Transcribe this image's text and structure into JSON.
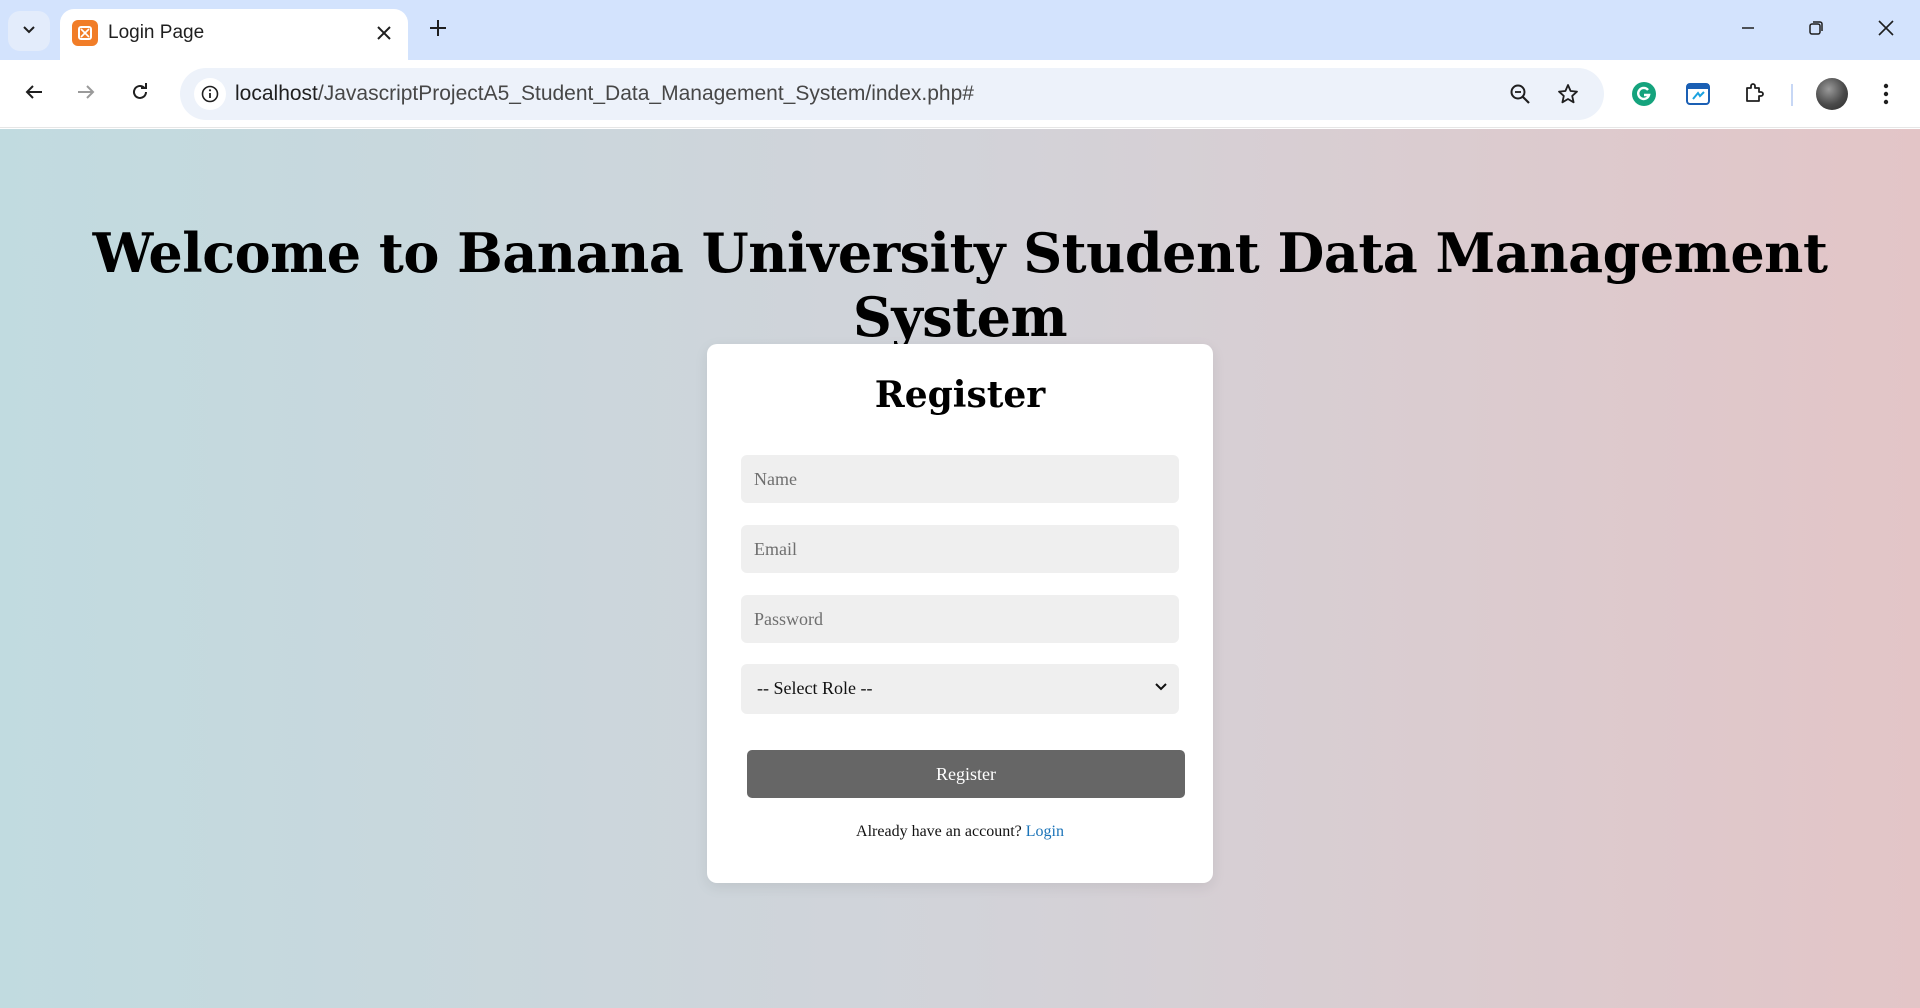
{
  "browser": {
    "tab": {
      "title": "Login Page"
    },
    "url": {
      "host": "localhost",
      "path": "/JavascriptProjectA5_Student_Data_Management_System/index.php#"
    }
  },
  "page": {
    "heading": "Welcome to Banana University Student Data Management System",
    "form": {
      "title": "Register",
      "name_placeholder": "Name",
      "email_placeholder": "Email",
      "password_placeholder": "Password",
      "role_selected": "-- Select Role --",
      "submit_label": "Register",
      "footer_text": "Already have an account?",
      "login_link": "Login"
    }
  },
  "colors": {
    "tabstrip": "#d3e3fd",
    "button": "#666666",
    "link": "#1a73b8",
    "gradient_left": "#c1dbe0",
    "gradient_right": "#e3c5c7"
  },
  "icons": [
    "tab-search-icon",
    "xampp-favicon-icon",
    "close-icon",
    "plus-icon",
    "minimize-icon",
    "restore-icon",
    "window-close-icon",
    "back-arrow-icon",
    "forward-arrow-icon",
    "reload-icon",
    "site-info-icon",
    "zoom-icon",
    "star-icon",
    "grammarly-icon",
    "extension-icon",
    "puzzle-icon",
    "more-vert-icon",
    "chevron-down-icon"
  ]
}
